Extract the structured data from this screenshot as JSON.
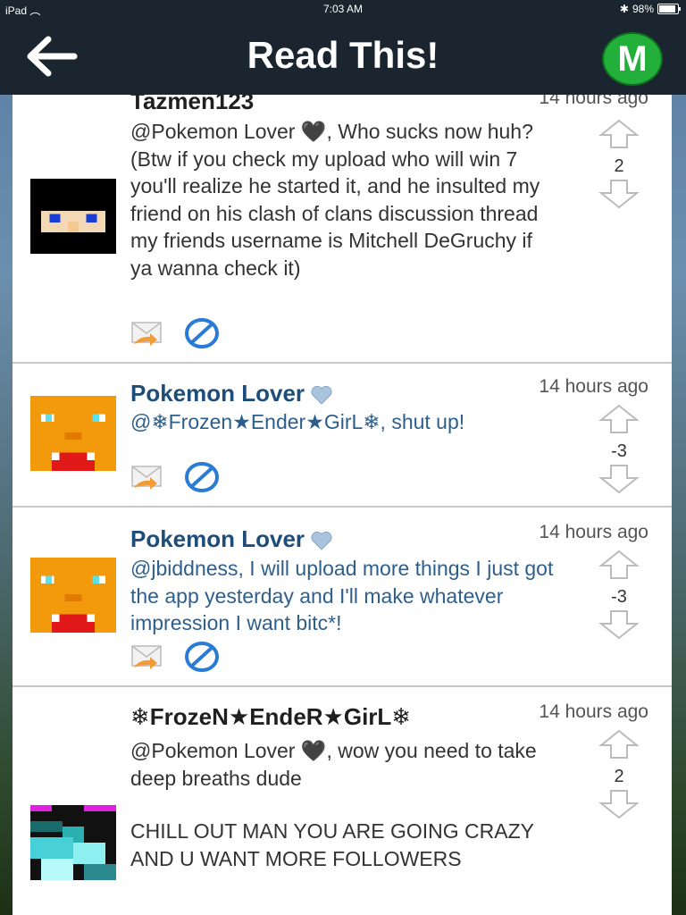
{
  "status": {
    "device": "iPad",
    "time": "7:03 AM",
    "battery": "98%"
  },
  "nav": {
    "title": "Read This!",
    "badge": "M"
  },
  "comments": [
    {
      "author": "Tazmen123",
      "time": "14 hours ago",
      "text": "@Pokemon Lover 🖤, Who sucks now huh? (Btw if you check my upload who will win 7 you'll realize he started it, and he insulted my friend on his clash of clans discussion thread my friends username is Mitchell DeGruchy if ya wanna check it)",
      "votes": "2"
    },
    {
      "author": "Pokemon Lover",
      "time": "14 hours ago",
      "text": "@❄Frozen★Ender★GirL❄, shut up!",
      "votes": "-3"
    },
    {
      "author": "Pokemon Lover",
      "time": "14 hours ago",
      "text": "@jbiddness, I will upload more things I just got the app yesterday and I'll make whatever impression I want bitc*!",
      "votes": "-3"
    },
    {
      "author": "❄FrozeN★EndeR★GirL❄",
      "time": "14 hours ago",
      "text": "@Pokemon Lover 🖤, wow you need to take deep breaths dude",
      "text2": "CHILL OUT MAN YOU ARE GOING CRAZY AND U WANT MORE FOLLOWERS",
      "votes": "2"
    }
  ],
  "icons": {
    "reply": "mail-reply-icon",
    "block": "block-icon",
    "up": "arrow-up-icon",
    "down": "arrow-down-icon"
  }
}
